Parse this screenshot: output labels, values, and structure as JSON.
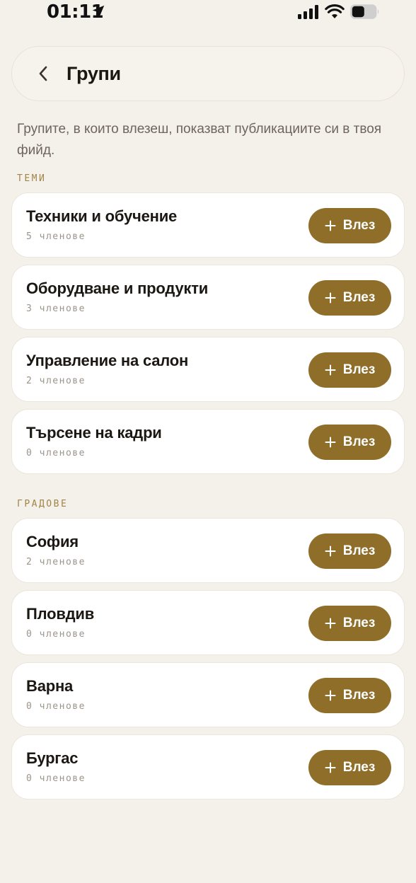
{
  "status_bar": {
    "time": "01:11"
  },
  "header": {
    "title": "Групи"
  },
  "intro": {
    "text": "Групите, в които влезеш, показват публикациите си в твоя фийд."
  },
  "sections": [
    {
      "label": "ТЕМИ",
      "groups": [
        {
          "name": "Техники и обучение",
          "members": "5 членове",
          "button": "Влез"
        },
        {
          "name": "Оборудване и продукти",
          "members": "3 членове",
          "button": "Влез"
        },
        {
          "name": "Управление на салон",
          "members": "2 членове",
          "button": "Влез"
        },
        {
          "name": "Търсене на кадри",
          "members": "0 членове",
          "button": "Влез"
        }
      ]
    },
    {
      "label": "ГРАДОВЕ",
      "groups": [
        {
          "name": "София",
          "members": "2 членове",
          "button": "Влез"
        },
        {
          "name": "Пловдив",
          "members": "0 членове",
          "button": "Влез"
        },
        {
          "name": "Варна",
          "members": "0 членове",
          "button": "Влез"
        },
        {
          "name": "Бургас",
          "members": "0 членове",
          "button": "Влез"
        }
      ]
    }
  ],
  "colors": {
    "background": "#F4F0EA",
    "accent": "#8F6E2A",
    "section_label": "#A08548",
    "card": "#FFFFFF"
  },
  "icons": {
    "back": "chevron-left-icon",
    "join": "plus-icon",
    "location": "location-arrow-icon",
    "signal": "cellular-signal-icon",
    "wifi": "wifi-icon",
    "battery": "battery-icon"
  }
}
